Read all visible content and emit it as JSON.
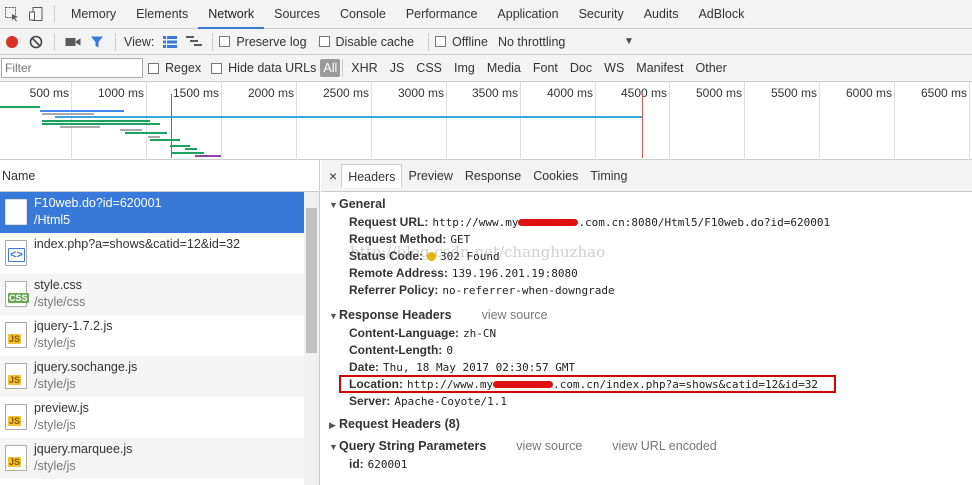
{
  "tabs": [
    "Memory",
    "Elements",
    "Network",
    "Sources",
    "Console",
    "Performance",
    "Application",
    "Security",
    "Audits",
    "AdBlock"
  ],
  "active_tab": "Network",
  "toolbar": {
    "view_label": "View:",
    "preserve_log": "Preserve log",
    "disable_cache": "Disable cache",
    "offline": "Offline",
    "throttling": "No throttling"
  },
  "filterbar": {
    "placeholder": "Filter",
    "regex": "Regex",
    "hide_data_urls": "Hide data URLs",
    "types": [
      "All",
      "XHR",
      "JS",
      "CSS",
      "Img",
      "Media",
      "Font",
      "Doc",
      "WS",
      "Manifest",
      "Other"
    ]
  },
  "timeline": {
    "ticks": [
      "500 ms",
      "1000 ms",
      "1500 ms",
      "2000 ms",
      "2500 ms",
      "3000 ms",
      "3500 ms",
      "4000 ms",
      "4500 ms",
      "5000 ms",
      "5500 ms",
      "6000 ms",
      "6500 ms"
    ]
  },
  "requests": {
    "header": "Name",
    "items": [
      {
        "name": "F10web.do?id=620001",
        "path": "/Html5",
        "type": "doc"
      },
      {
        "name": "index.php?a=shows&catid=12&id=32",
        "path": "",
        "type": "html"
      },
      {
        "name": "style.css",
        "path": "/style/css",
        "type": "css"
      },
      {
        "name": "jquery-1.7.2.js",
        "path": "/style/js",
        "type": "js"
      },
      {
        "name": "jquery.sochange.js",
        "path": "/style/js",
        "type": "js"
      },
      {
        "name": "preview.js",
        "path": "/style/js",
        "type": "js"
      },
      {
        "name": "jquery.marquee.js",
        "path": "/style/js",
        "type": "js"
      }
    ]
  },
  "details": {
    "close": "×",
    "tabs": [
      "Headers",
      "Preview",
      "Response",
      "Cookies",
      "Timing"
    ],
    "general": {
      "title": "General",
      "request_url_key": "Request URL:",
      "request_url_pre": "http://www.my",
      "request_url_post": ".com.cn:8080/Html5/F10web.do?id=620001",
      "method_key": "Request Method:",
      "method": "GET",
      "status_key": "Status Code:",
      "status": "302 Found",
      "remote_key": "Remote Address:",
      "remote": "139.196.201.19:8080",
      "referrer_key": "Referrer Policy:",
      "referrer": "no-referrer-when-downgrade"
    },
    "response_headers": {
      "title": "Response Headers",
      "view_source": "view source",
      "lang_key": "Content-Language:",
      "lang": "zh-CN",
      "len_key": "Content-Length:",
      "len": "0",
      "date_key": "Date:",
      "date": "Thu, 18 May 2017 02:30:57 GMT",
      "loc_key": "Location:",
      "loc_pre": "http://www.my",
      "loc_post": ".com.cn/index.php?a=shows&catid=12&id=32",
      "server_key": "Server:",
      "server": "Apache-Coyote/1.1"
    },
    "request_headers": {
      "title": "Request Headers (8)"
    },
    "query": {
      "title": "Query String Parameters",
      "view_source": "view source",
      "view_encoded": "view URL encoded",
      "id_key": "id:",
      "id": "620001"
    }
  },
  "watermark": "http://blog.csdn.net/changhuzhao",
  "colors": {
    "accent": "#3879d9",
    "record": "#d93025",
    "highlight": "#d40000"
  }
}
